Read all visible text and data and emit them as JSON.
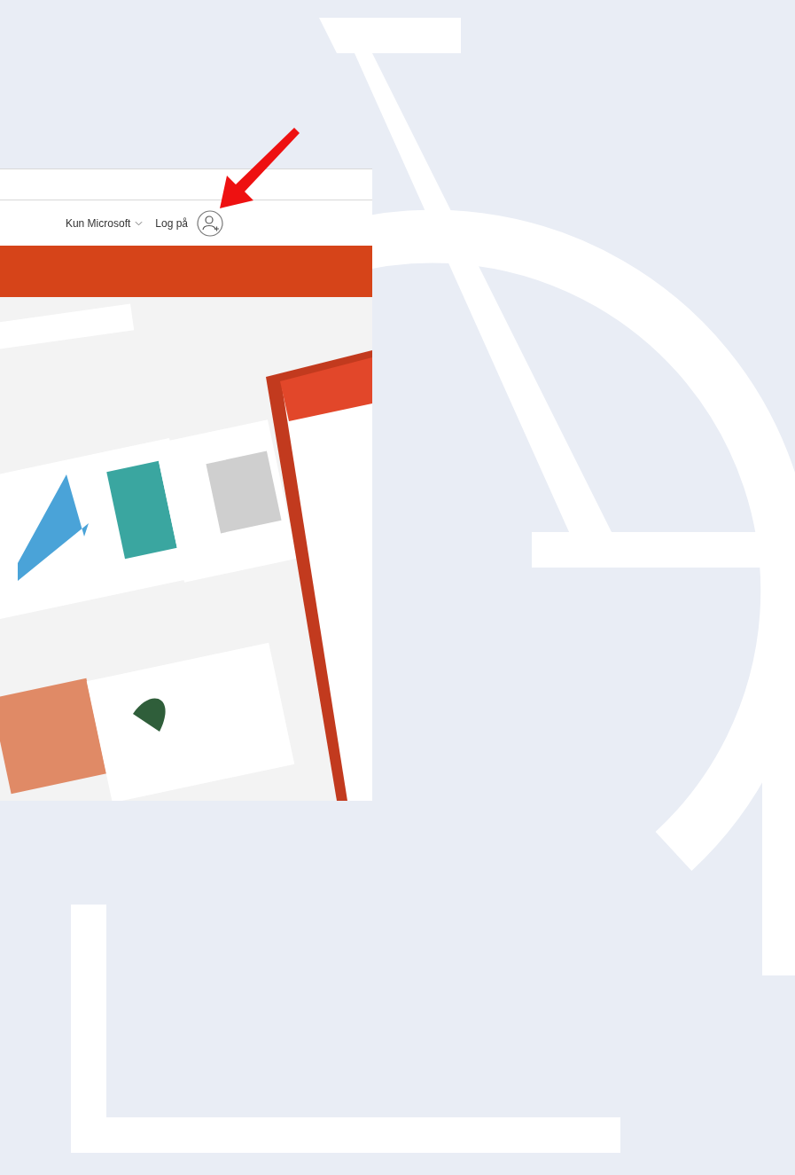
{
  "header": {
    "menu": {
      "label": "Kun Microsoft"
    },
    "sign_in": {
      "label": "Log på"
    }
  }
}
